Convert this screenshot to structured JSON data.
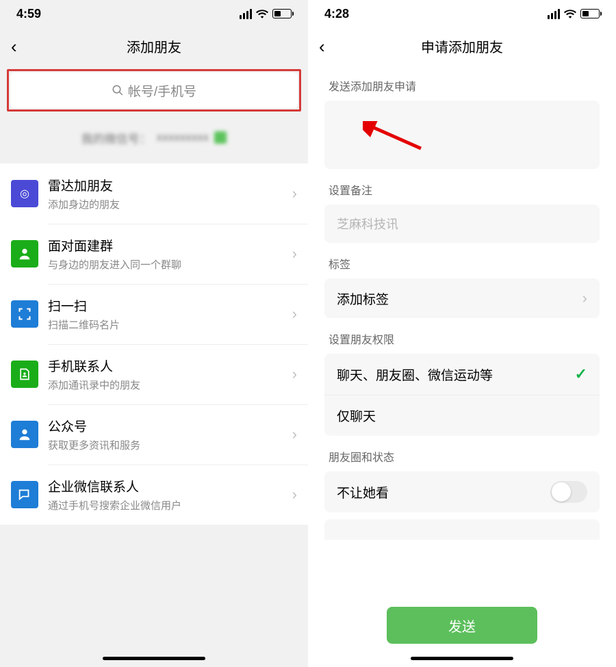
{
  "left": {
    "status": {
      "time": "4:59"
    },
    "nav": {
      "title": "添加朋友"
    },
    "search": {
      "placeholder": "帐号/手机号"
    },
    "items": [
      {
        "title": "雷达加朋友",
        "sub": "添加身边的朋友",
        "color": "#4a4ad6",
        "icon": "radar-icon"
      },
      {
        "title": "面对面建群",
        "sub": "与身边的朋友进入同一个群聊",
        "color": "#1aad19",
        "icon": "group-icon"
      },
      {
        "title": "扫一扫",
        "sub": "扫描二维码名片",
        "color": "#1e7dd6",
        "icon": "scan-icon"
      },
      {
        "title": "手机联系人",
        "sub": "添加通讯录中的朋友",
        "color": "#1aad19",
        "icon": "phone-contact-icon"
      },
      {
        "title": "公众号",
        "sub": "获取更多资讯和服务",
        "color": "#1e7dd6",
        "icon": "official-account-icon"
      },
      {
        "title": "企业微信联系人",
        "sub": "通过手机号搜索企业微信用户",
        "color": "#1e7dd6",
        "icon": "wecom-icon"
      }
    ]
  },
  "right": {
    "status": {
      "time": "4:28"
    },
    "nav": {
      "title": "申请添加朋友"
    },
    "labels": {
      "request": "发送添加朋友申请",
      "remark": "设置备注",
      "tag": "标签",
      "perm": "设置朋友权限",
      "moments": "朋友圈和状态"
    },
    "remark_value": "芝麻科技讯",
    "tag_action": "添加标签",
    "perm_options": {
      "all": "聊天、朋友圈、微信运动等",
      "chat_only": "仅聊天"
    },
    "moments_block": "不让她看",
    "send": "发送"
  }
}
